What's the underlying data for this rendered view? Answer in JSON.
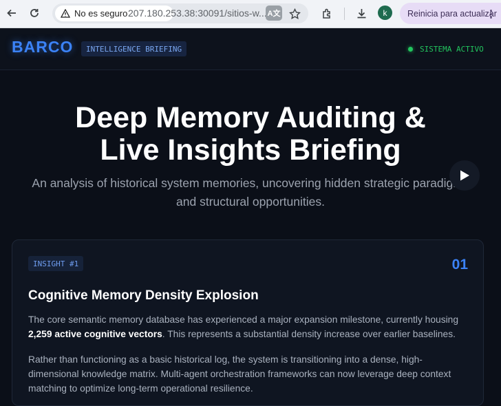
{
  "browser": {
    "security_label": "No es seguro",
    "url": "207.180.253.38:30091/sitios-w...",
    "update_label": "Reinicia para actualizar",
    "avatar_letter": "k"
  },
  "header": {
    "brand": "BARCO",
    "tag": "INTELLIGENCE BRIEFING",
    "status": "SISTEMA ACTIVO",
    "status_color": "#22c55e",
    "accent_color": "#3b82f6"
  },
  "hero": {
    "title_line1": "Deep Memory Auditing &",
    "title_line2": "Live Insights Briefing",
    "subtitle_line1": "An analysis of historical system memories, uncovering hidden strategic paradigms",
    "subtitle_line2": "and structural opportunities."
  },
  "insight": {
    "badge": "INSIGHT #1",
    "number": "01",
    "title": "Cognitive Memory Density Explosion",
    "p1_before": "The core semantic memory database has experienced a major expansion milestone, currently housing ",
    "p1_bold": "2,259 active cognitive vectors",
    "p1_after": ". This represents a substantial density increase over earlier baselines.",
    "p2": "Rather than functioning as a basic historical log, the system is transitioning into a dense, high-dimensional knowledge matrix. Multi-agent orchestration frameworks can now leverage deep context matching to optimize long-term operational resilience."
  }
}
